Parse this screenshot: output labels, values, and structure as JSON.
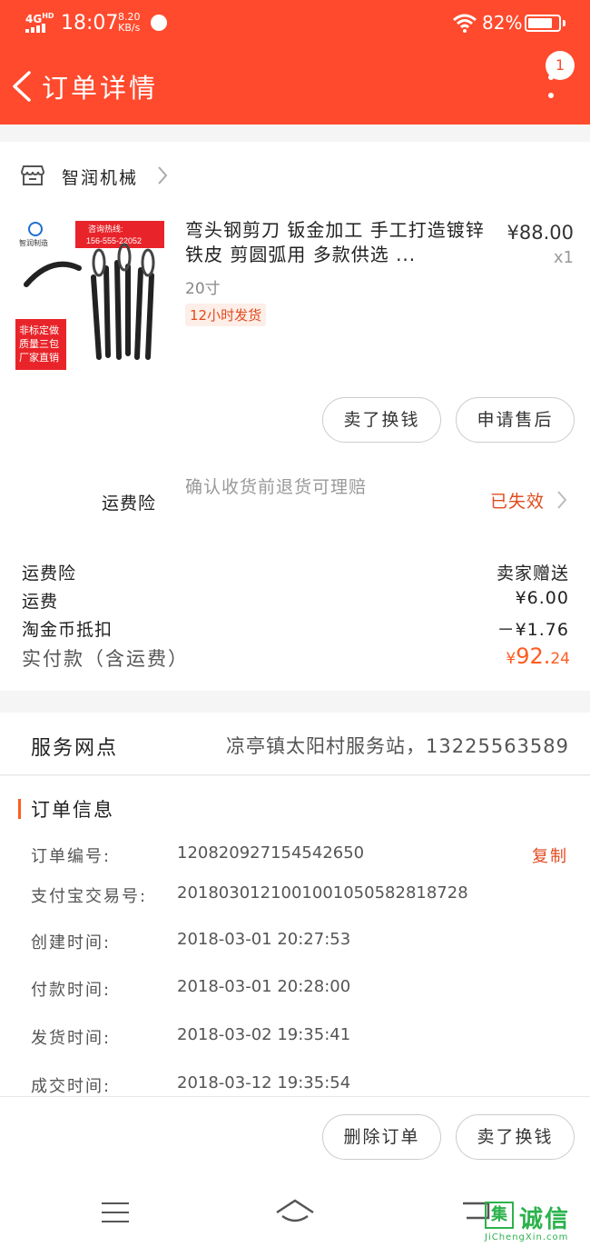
{
  "status_bar": {
    "network": "4G",
    "network_sup": "HD",
    "time": "18:07",
    "speed_value": "8.20",
    "speed_unit": "KB/s",
    "battery_pct": "82%",
    "battery_level": 0.82
  },
  "header": {
    "title": "订单详情",
    "badge_count": "1"
  },
  "shop": {
    "name": "智润机械"
  },
  "product": {
    "title": "弯头钢剪刀 钣金加工 手工打造镀锌铁皮 剪圆弧用 多款供选 ...",
    "spec": "20寸",
    "tag": "12小时发货",
    "price": "¥88.00",
    "qty": "x1",
    "image_text": {
      "hotline_label": "咨询热线:",
      "hotline_number": "156-555-22052",
      "brand": "智润制造",
      "badge1": "非标定做",
      "badge2": "质量三包",
      "badge3": "厂家直销"
    }
  },
  "product_actions": {
    "sell": "卖了换钱",
    "after_sale": "申请售后"
  },
  "insurance": {
    "label": "运费险",
    "desc": "确认收货前退货可理赔",
    "status": "已失效"
  },
  "fees": [
    {
      "label": "运费险",
      "value": "卖家赠送"
    },
    {
      "label": "运费",
      "value": "¥6.00"
    },
    {
      "label": "淘金币抵扣",
      "value": "－¥1.76"
    }
  ],
  "total": {
    "label": "实付款（含运费）",
    "currency": "¥",
    "integer": "92.",
    "decimal": "24"
  },
  "service": {
    "label": "服务网点",
    "value": "凉亭镇太阳村服务站，13225563589"
  },
  "order_info": {
    "title": "订单信息",
    "copy_label": "复制",
    "rows": [
      {
        "label": "订单编号:",
        "value": "120820927154542650"
      },
      {
        "label": "支付宝交易号:",
        "value": "2018030121001001050582818728"
      },
      {
        "label": "创建时间:",
        "value": "2018-03-01 20:27:53"
      },
      {
        "label": "付款时间:",
        "value": "2018-03-01 20:28:00"
      },
      {
        "label": "发货时间:",
        "value": "2018-03-02 19:35:41"
      },
      {
        "label": "成交时间:",
        "value": "2018-03-12 19:35:54"
      }
    ]
  },
  "bottom_actions": {
    "delete": "删除订单",
    "sell": "卖了换钱"
  },
  "watermark": {
    "logo": "集",
    "text": "诚信",
    "url": "JiChengXin.com"
  },
  "colors": {
    "header_bg": "#ff4a2d",
    "accent": "#ff5b1f",
    "link": "#e14b1f"
  }
}
